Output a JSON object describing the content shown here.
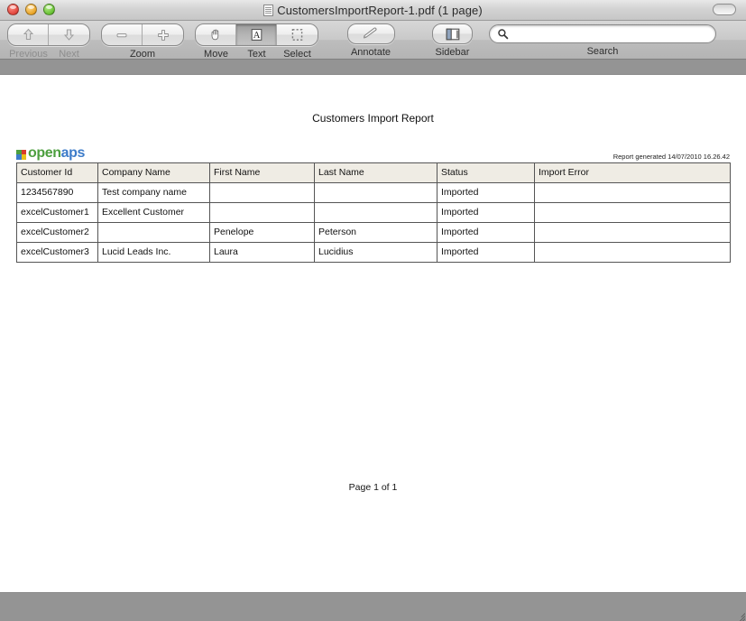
{
  "window": {
    "title": "CustomersImportReport-1.pdf (1 page)",
    "doc_icon": "pdf-document-icon",
    "traffic_lights": [
      "close",
      "minimize",
      "zoom"
    ],
    "toolbar_toggle": "toolbar-toggle-button"
  },
  "toolbar": {
    "nav": {
      "previous_label": "Previous",
      "next_label": "Next",
      "previous_icon": "arrow-up-icon",
      "next_icon": "arrow-down-icon"
    },
    "zoom": {
      "group_label": "Zoom",
      "out_icon": "minus-icon",
      "in_icon": "plus-icon"
    },
    "tools": {
      "move_label": "Move",
      "text_label": "Text",
      "select_label": "Select",
      "move_icon": "hand-icon",
      "text_icon": "letter-a-icon",
      "select_icon": "marquee-select-icon",
      "selected": "Text"
    },
    "annotate": {
      "label": "Annotate",
      "icon": "pencil-icon"
    },
    "sidebar": {
      "label": "Sidebar",
      "icon": "sidebar-panel-icon"
    },
    "search": {
      "label": "Search",
      "placeholder": "",
      "value": "",
      "icon": "search-icon"
    }
  },
  "document": {
    "report_title": "Customers Import Report",
    "logo": {
      "text_a": "open",
      "text_b": "aps",
      "mark_colors": [
        "#4d9f3f",
        "#d93b2b",
        "#3d7cc9",
        "#e8c019"
      ],
      "color_a": "#4d9f3f",
      "color_b": "#3d7cc9"
    },
    "generated": "Report generated 14/07/2010 16.26.42",
    "table": {
      "columns": [
        "Customer Id",
        "Company Name",
        "First Name",
        "Last Name",
        "Status",
        "Import Error"
      ],
      "rows": [
        [
          "1234567890",
          "Test company name",
          "",
          "",
          "Imported",
          ""
        ],
        [
          "excelCustomer1",
          "Excellent Customer",
          "",
          "",
          "Imported",
          ""
        ],
        [
          "excelCustomer2",
          "",
          "Penelope",
          "Peterson",
          "Imported",
          ""
        ],
        [
          "excelCustomer3",
          "Lucid Leads Inc.",
          "Laura",
          "Lucidius",
          "Imported",
          ""
        ]
      ]
    },
    "footer": "Page 1 of 1"
  },
  "colors": {
    "header_bg": "#efece4",
    "toolbar_bg": "#c4c4c4",
    "chrome_gray": "#949494"
  }
}
